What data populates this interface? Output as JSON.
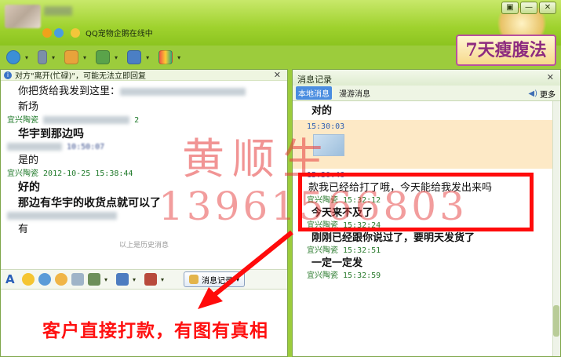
{
  "header": {
    "status_text": "QQ宠物企鹅在线中",
    "ad_text": "7天瘦腹法",
    "window_buttons": [
      "▣",
      "—",
      "✕"
    ]
  },
  "toolbar": {
    "icons": [
      "camera-icon",
      "microphone-icon",
      "transfer-file-icon",
      "add-contact-icon",
      "screen-share-icon",
      "apps-icon"
    ]
  },
  "left_pane": {
    "notice": "对方\"离开(忙碌)\"，可能无法立即回复",
    "close_label": "✕",
    "messages": [
      {
        "type": "text",
        "text": "你把货给我发到这里："
      },
      {
        "type": "text",
        "text": "新场"
      },
      {
        "type": "sender",
        "name": "宜兴陶瓷",
        "time": "2"
      },
      {
        "type": "bold",
        "text": "华宇到那边吗"
      },
      {
        "type": "sender-other",
        "time": "10:50:07"
      },
      {
        "type": "text",
        "text": "是的"
      },
      {
        "type": "sender",
        "name": "宜兴陶瓷",
        "time": "2012-10-25 15:38:44"
      },
      {
        "type": "bold",
        "text": "好的"
      },
      {
        "type": "bold",
        "text": "那边有华宇的收货点就可以了"
      },
      {
        "type": "sender-other",
        "time": ""
      },
      {
        "type": "text",
        "text": "有"
      }
    ],
    "divider": "以上是历史消息",
    "history_button": "消息记录"
  },
  "right_pane": {
    "title": "消息记录",
    "close_label": "✕",
    "tabs": [
      "本地消息",
      "漫游消息"
    ],
    "more_label": "更多",
    "entries": [
      {
        "kind": "msg",
        "text": "对的",
        "bold": true
      },
      {
        "kind": "time-blue",
        "text": "15:30:03"
      },
      {
        "kind": "time-blue",
        "text": "15:30:46"
      },
      {
        "kind": "msg",
        "text": "款我已经给打了哦，今天能给我发出来吗"
      },
      {
        "kind": "time",
        "text": "宜兴陶瓷 15:32:12"
      },
      {
        "kind": "msg",
        "text": "今天来不及了",
        "bold": true
      },
      {
        "kind": "time",
        "text": "宜兴陶瓷 15:32:24"
      },
      {
        "kind": "msg",
        "text": "刚刚已经跟你说过了，要明天发货了",
        "bold": true
      },
      {
        "kind": "time",
        "text": "宜兴陶瓷 15:32:51"
      },
      {
        "kind": "msg",
        "text": "一定一定发",
        "bold": true
      },
      {
        "kind": "time",
        "text": "宜兴陶瓷 15:32:59"
      }
    ]
  },
  "overlay": {
    "watermark_name": "黄顺生",
    "watermark_phone": "13961566803",
    "caption": "客户直接打款，有图有真相",
    "highlight_color": "#ff0b0b"
  }
}
